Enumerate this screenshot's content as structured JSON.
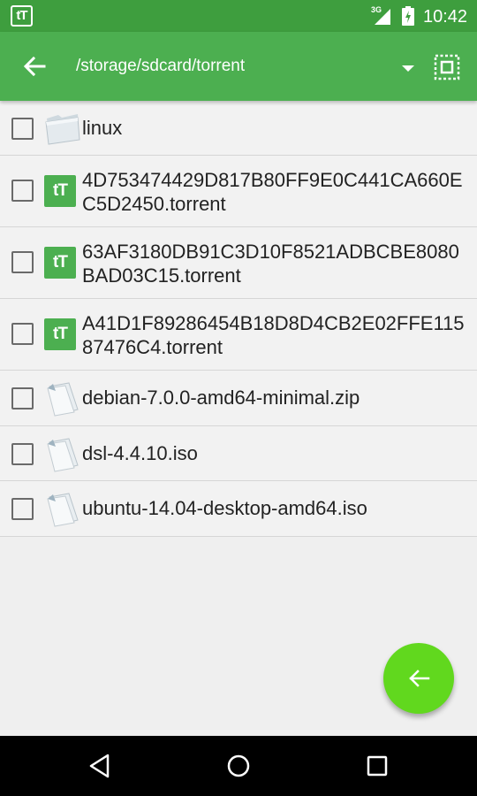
{
  "status_bar": {
    "app_icon_text": "tT",
    "network": "3G",
    "time": "10:42"
  },
  "toolbar": {
    "path": "/storage/sdcard/torrent"
  },
  "files": [
    {
      "name": "linux",
      "type": "folder"
    },
    {
      "name": "4D753474429D817B80FF9E0C441CA660EC5D2450.torrent",
      "type": "torrent"
    },
    {
      "name": "63AF3180DB91C3D10F8521ADBCBE8080BAD03C15.torrent",
      "type": "torrent"
    },
    {
      "name": "A41D1F89286454B18D8D4CB2E02FFE11587476C4.torrent",
      "type": "torrent"
    },
    {
      "name": "debian-7.0.0-amd64-minimal.zip",
      "type": "file"
    },
    {
      "name": "dsl-4.4.10.iso",
      "type": "file"
    },
    {
      "name": "ubuntu-14.04-desktop-amd64.iso",
      "type": "file"
    }
  ],
  "torrent_icon_text": "tT",
  "colors": {
    "status_bar": "#3e9e3e",
    "toolbar": "#4caf50",
    "fab": "#61d81e",
    "torrent_icon": "#4caf50"
  }
}
